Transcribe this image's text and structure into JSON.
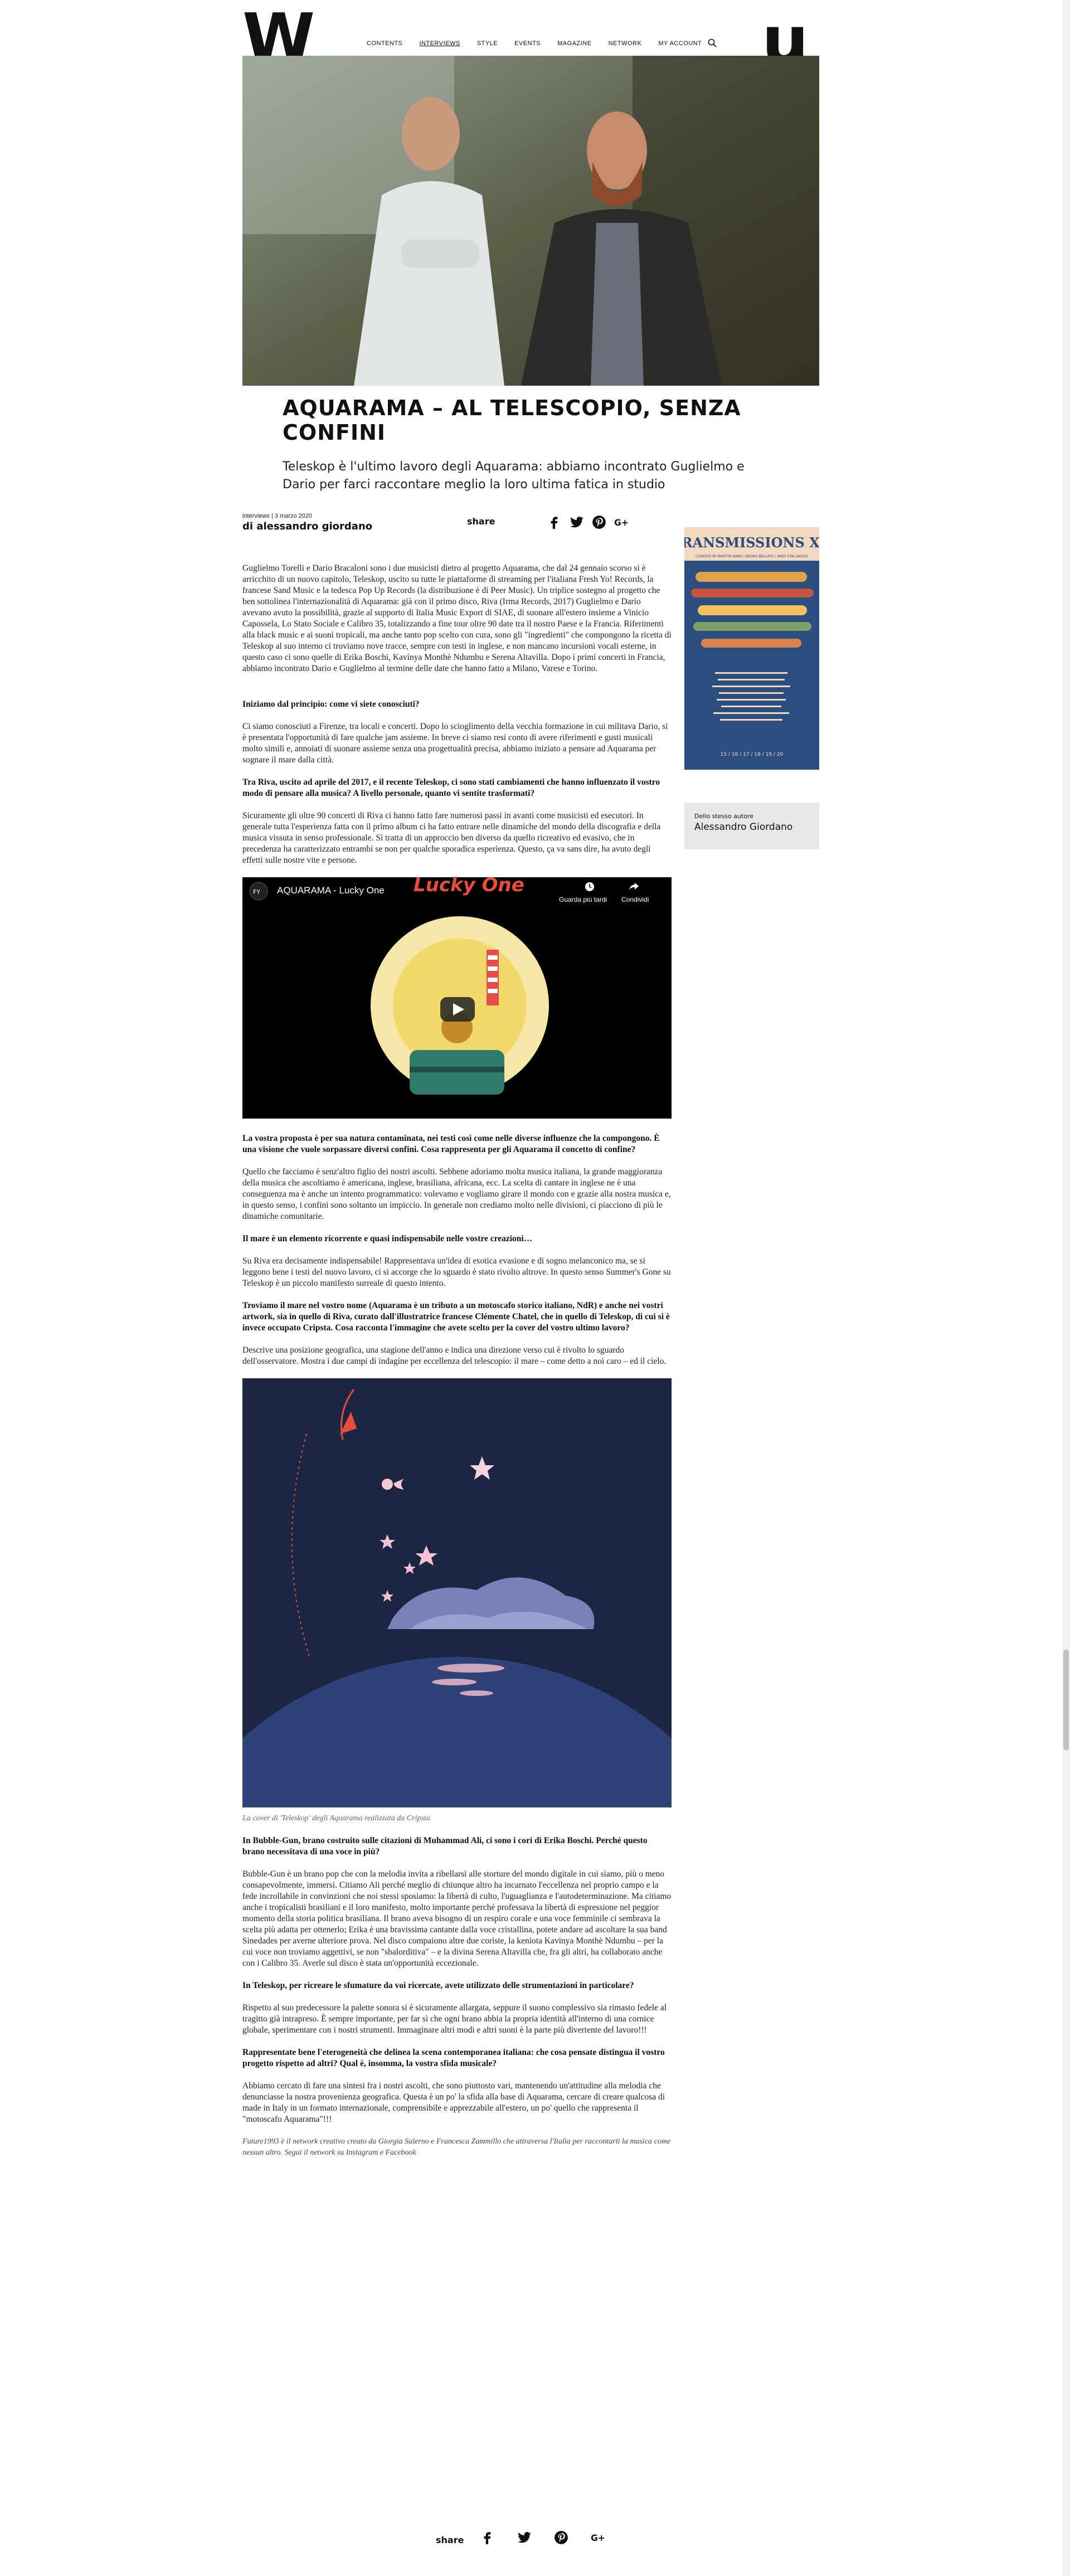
{
  "header": {
    "logo_left": "W",
    "logo_right": "u",
    "nav": [
      "CONTENTS",
      "INTERVIEWS",
      "STYLE",
      "EVENTS",
      "MAGAZINE",
      "NETWORK",
      "MY ACCOUNT"
    ],
    "active_nav": "INTERVIEWS"
  },
  "article": {
    "title": "AQUARAMA – AL TELESCOPIO, SENZA CONFINI",
    "subtitle": "Teleskop è l'ultimo lavoro degli Aquarama: abbiamo incontrato Guglielmo e Dario per farci raccontare meglio la loro ultima fatica in studio",
    "meta": "interviews | 3 marzo 2020",
    "author": "di alessandro giordano",
    "share_label": "share",
    "intro": "Guglielmo Torelli e Dario Bracaloni sono i due musicisti dietro al progetto Aquarama, che dal 24 gennaio scorso si è arricchito di un nuovo capitolo, Teleskop, uscito su tutte le piattaforme di streaming per l'italiana Fresh Yo! Records, la francese Sand Music e la tedesca Pop Up Records (la distribuzione è di Peer Music). Un triplice sostegno al progetto che ben sottolinea l'internazionalità di Aquarama: già con il primo disco, Riva (Irma Records, 2017) Guglielmo e Dario avevano avuto la possibilità, grazie al supporto di Italia Music Export di SIAE, di suonare all'estero insieme a Vinicio Capossela, Lo Stato Sociale e Calibro 35, totalizzando a fine tour oltre 90 date tra il nostro Paese e la Francia. Riferimenti alla black music e ai suoni tropicali, ma anche tanto pop scelto con cura, sono gli \"ingredienti\" che compongono la ricetta di Teleskop al suo interno ci troviamo nove tracce, sempre con testi in inglese, e non mancano incursioni vocali esterne, in questo caso ci sono quelle di Erika Boschi, Kavinya Monthè Ndumbu e Serena Altavilla. Dopo i primi concerti in Francia, abbiamo incontrato Dario e Guglielmo al termine delle date che hanno fatto a Milano, Varese e Torino.",
    "qa": [
      {
        "q": "Iniziamo dal principio: come vi siete conosciuti?",
        "a": "Ci siamo conosciuti a Firenze, tra locali e concerti. Dopo lo scioglimento della vecchia formazione in cui militava Dario, si è presentata l'opportunità di fare qualche jam assieme. In breve ci siamo resi conto di avere riferimenti e gusti musicali molto simili e, annoiati di suonare assieme senza una progettualità precisa, abbiamo iniziato a pensare ad Aquarama per sognare il mare dalla città."
      },
      {
        "q": "Tra Riva, uscito ad aprile del 2017, e il recente Teleskop, ci sono stati cambiamenti che hanno influenzato il vostro modo di pensare alla musica? A livello personale, quanto vi sentite trasformati?",
        "a": "Sicuramente gli oltre 90 concerti di Riva ci hanno fatto fare numerosi passi in avanti come musicisti ed esecutori. In generale tutta l'esperienza fatta con il primo album ci ha fatto entrare nelle dinamiche del mondo della discografia e della musica vissuta in senso professionale. Si tratta di un approccio ben diverso da quello ricreativo ed evasivo, che in precedenza ha caratterizzato entrambi se non per qualche sporadica esperienza. Questo, ça va sans dire, ha avuto degli effetti sulle nostre vite e persone."
      }
    ],
    "video": {
      "title": "AQUARAMA - Lucky One",
      "watch_later": "Guarda più tardi",
      "share": "Condividi",
      "artwork_text": "Lucky One"
    },
    "qa2": [
      {
        "q": "La vostra proposta è per sua natura contaminata, nei testi così come nelle diverse influenze che la compongono. È una visione che vuole sorpassare diversi confini. Cosa rappresenta per gli Aquarama il concetto di confine?",
        "a": "Quello che facciamo è senz'altro figlio dei nostri ascolti. Sebbene adoriamo molta musica italiana, la grande maggioranza della musica che ascoltiamo è americana, inglese, brasiliana, africana, ecc. La scelta di cantare in inglese ne è una conseguenza ma è anche un intento programmatico: volevamo e vogliamo girare il mondo con e grazie alla nostra musica e, in questo senso, i confini sono soltanto un impiccio. In generale non crediamo molto nelle divisioni, ci piacciono di più le dinamiche comunitarie."
      },
      {
        "q": "Il mare è un elemento ricorrente e quasi indispensabile nelle vostre creazioni…",
        "a": "Su Riva era decisamente indispensabile! Rappresentava un'idea di esotica evasione e di sogno melanconico ma, se si leggono bene i testi del nuovo lavoro, ci si accorge che lo sguardo è stato rivolto altrove. In questo senso Summer's Gone su Teleskop è un piccolo manifesto surreale di questo intento."
      },
      {
        "q": "Troviamo il mare nel vostro nome (Aquarama è un tributo a un motoscafo storico italiano, NdR) e anche nei vostri artwork, sia in quello di Riva, curato dall'illustratrice francese Clémente Chatel, che in quello di Teleskop, di cui si è invece occupato Cripsta. Cosa racconta l'immagine che avete scelto per la cover del vostro ultimo lavoro?",
        "a": "Descrive una posizione geografica, una stagione dell'anno e indica una direzione verso cui è rivolto lo sguardo dell'osservatore. Mostra i due campi di indagine per eccellenza del telescopio: il mare – come detto a noi caro – ed il cielo."
      }
    ],
    "cover_caption": "La cover di 'Teleskop' degli Aquarama realizzata da Cripsta",
    "qa3": [
      {
        "q": "In Bubble-Gun, brano costruito sulle citazioni di Muhammad Ali, ci sono i cori di Erika Boschi. Perché questo brano necessitava di una voce in più?",
        "a": "Bubble-Gun è un brano pop che con la melodia invita a ribellarsi alle storture del mondo digitale in cui siamo, più o meno consapevolmente, immersi. Citiamo Ali perché meglio di chiunque altro ha incarnato l'eccellenza nel proprio campo e la fede incrollabile in convinzioni che noi stessi sposiamo: la libertà di culto, l'uguaglianza e l'autodeterminazione. Ma citiamo anche i tropicalisti brasiliani e il loro manifesto, molto importante perché professava la libertà di espressione nel peggior momento della storia politica brasiliana. Il brano aveva bisogno di un respiro corale e una voce femminile ci sembrava la scelta più adatta per ottenerlo; Erika è una bravissima cantante dalla voce cristallina, potete andare ad ascoltare la sua band Sinedades per averne ulteriore prova. Nel disco compaiono altre due coriste, la keniota Kavinya Monthè Ndumbu – per la cui voce non troviamo aggettivi, se non \"sbalorditiva\" – e la divina Serena Altavilla che, fra gli altri, ha collaborato anche con i Calibro 35. Averle sul disco è stata un'opportunità eccezionale."
      },
      {
        "q": "In Teleskop, per ricreare le sfumature da voi ricercate, avete utilizzato delle strumentazioni in particolare?",
        "a": "Rispetto al suo predecessore la palette sonora si è sicuramente allargata, seppure il suono complessivo sia rimasto fedele al tragitto già intrapreso. È sempre importante, per far sì che ogni brano abbia la propria identità all'interno di una cornice globale, sperimentare con i nostri strumenti. Immaginare altri modi e altri suoni è la parte più divertente del lavoro!!!"
      },
      {
        "q": "Rappresentate bene l'eterogeneità che delinea la scena contemporanea italiana: che cosa pensate distingua il vostro progetto rispetto ad altri? Qual è, insomma, la vostra sfida musicale?",
        "a": "Abbiamo cercato di fare una sintesi fra i nostri ascolti, che sono piuttosto vari, mantenendo un'attitudine alla melodia che denunciasse la nostra provenienza geografica. Questa è un po' la sfida alla base di Aquarama, cercare di creare qualcosa di made in Italy in un formato internazionale, comprensibile e apprezzabile all'estero, un po' quello che rappresenta il \"motoscafo Aquarama\"!!!"
      }
    ],
    "footer_note": "Future1993 è il network creativo creato da Giorgia Salerno e Francesca Zammillo che attraversa l'Italia per raccontarti la musica come nessun altro. Segui il network su Instagram e Facebook",
    "footer_share": "share"
  },
  "sidebar": {
    "ad": {
      "title": "TRANSMISSIONS XII",
      "subtitle": "CURATED BY MARTYN WARE / BRUNO BELLATO / ANDY STALLWOOD",
      "dates": "15 / 16 / 17 / 18 / 19 / 20"
    },
    "author_box_label": "Dello stesso autore",
    "author_box_name": "Alessandro Giordano"
  },
  "colors": {
    "ad_bg": "#2a4e7f",
    "night_bg": "#1c2642",
    "sea": "#2f4277"
  }
}
